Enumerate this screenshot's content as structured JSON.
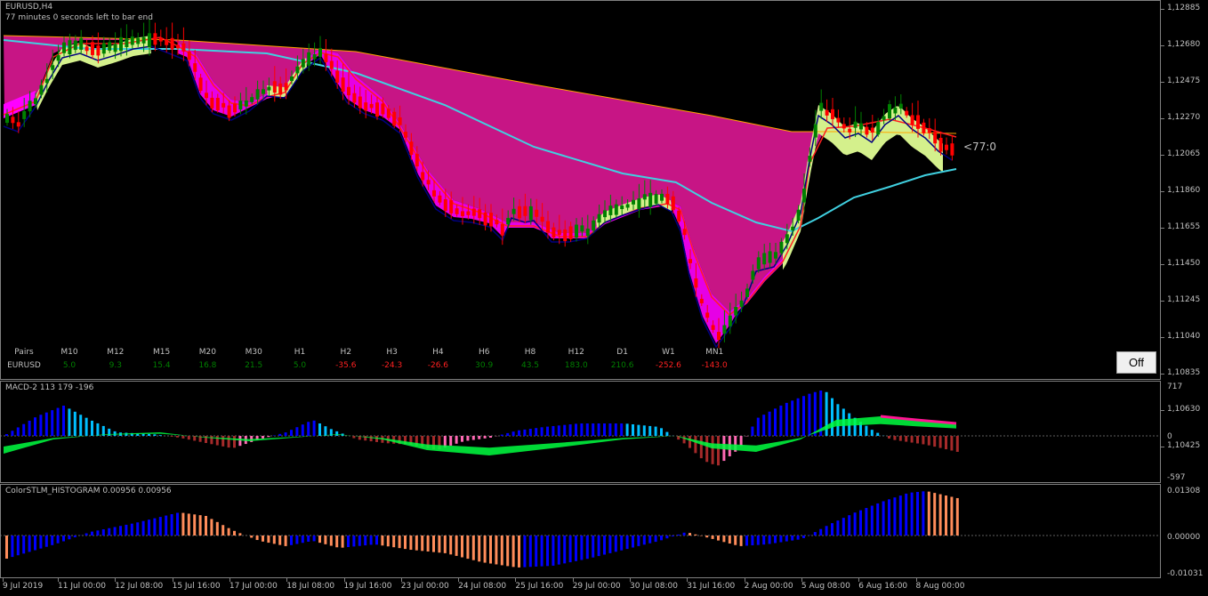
{
  "main": {
    "symbol_title": "EURUSD,H4",
    "bar_timer_text": "77 minutes 0 seconds left to bar end",
    "countdown": "<77:0",
    "off_button": "Off",
    "price_scale": [
      "1,12885",
      "1,12680",
      "1,12475",
      "1,12270",
      "1,12065",
      "1,11860",
      "1,11655",
      "1,11450",
      "1,11245",
      "1,11040",
      "1,10835",
      "1,10630",
      "1,10425"
    ]
  },
  "strength_table": {
    "pairs_label": "Pairs",
    "symbol": "EURUSD",
    "columns": [
      {
        "tf": "M10",
        "value": "5.0",
        "sign": "pos"
      },
      {
        "tf": "M12",
        "value": "9.3",
        "sign": "pos"
      },
      {
        "tf": "M15",
        "value": "15.4",
        "sign": "pos"
      },
      {
        "tf": "M20",
        "value": "16.8",
        "sign": "pos"
      },
      {
        "tf": "M30",
        "value": "21.5",
        "sign": "pos"
      },
      {
        "tf": "H1",
        "value": "5.0",
        "sign": "pos"
      },
      {
        "tf": "H2",
        "value": "-35.6",
        "sign": "neg"
      },
      {
        "tf": "H3",
        "value": "-24.3",
        "sign": "neg"
      },
      {
        "tf": "H4",
        "value": "-26.6",
        "sign": "neg"
      },
      {
        "tf": "H6",
        "value": "30.9",
        "sign": "pos"
      },
      {
        "tf": "H8",
        "value": "43.5",
        "sign": "pos"
      },
      {
        "tf": "H12",
        "value": "183.0",
        "sign": "pos"
      },
      {
        "tf": "D1",
        "value": "210.6",
        "sign": "pos"
      },
      {
        "tf": "W1",
        "value": "-252.6",
        "sign": "neg"
      },
      {
        "tf": "MN1",
        "value": "-143.0",
        "sign": "neg"
      }
    ]
  },
  "macd": {
    "title": "MACD-2 113 179 -196",
    "scale": [
      "717",
      "0",
      "-597"
    ]
  },
  "stlm": {
    "title": "ColorSTLM_HISTOGRAM 0.00956 0.00956",
    "scale": [
      "0.01308",
      "0.00000",
      "-0.01031"
    ]
  },
  "time_axis": [
    "9 Jul 2019",
    "11 Jul 00:00",
    "12 Jul 08:00",
    "15 Jul 16:00",
    "17 Jul 00:00",
    "18 Jul 08:00",
    "19 Jul 16:00",
    "23 Jul 00:00",
    "24 Jul 08:00",
    "25 Jul 16:00",
    "29 Jul 00:00",
    "30 Jul 08:00",
    "31 Jul 16:00",
    "2 Aug 00:00",
    "5 Aug 08:00",
    "6 Aug 16:00",
    "8 Aug 00:00"
  ],
  "colors": {
    "bull_candle": "#008000",
    "bear_candle": "#ff0000",
    "cloud_magenta": "#c71585",
    "cloud_pink": "#ff00ff",
    "cloud_yellow": "#d4f08c",
    "ma_cyan": "#40d0e0",
    "ma_navy": "#000080",
    "ma_red": "#ff2020",
    "ma_orange": "#ffa500",
    "macd_blue": "#0000ff",
    "macd_lightblue": "#00bfff",
    "macd_pink": "#ff69b4",
    "macd_brown": "#a52a2a",
    "macd_green": "#00ff40",
    "stlm_blue": "#0000ff",
    "stlm_orange": "#ff8c5a"
  }
}
